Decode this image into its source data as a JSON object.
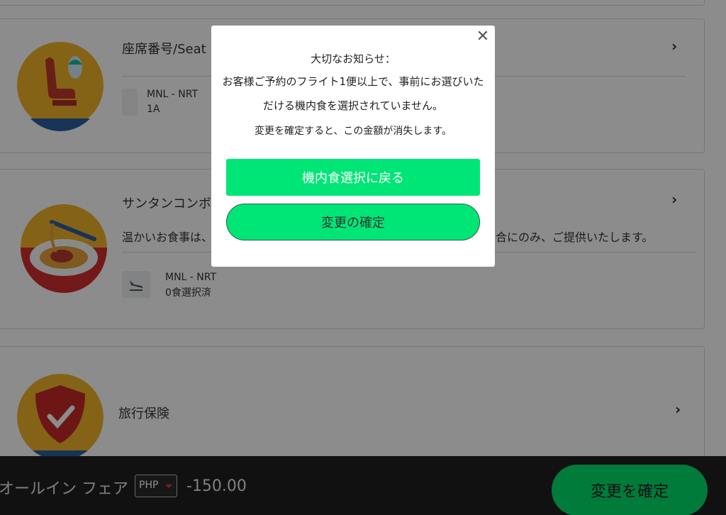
{
  "seat_card": {
    "title": "座席番号/Seat",
    "route": "MNL - NRT",
    "seat": "1A"
  },
  "meal_card": {
    "title": "サンタンコンボ",
    "desc_left": "温かいお食事は、",
    "desc_right": "合にのみ、ご提供いたします。",
    "route": "MNL - NRT",
    "status": "0食選択済"
  },
  "insurance_card": {
    "title": "旅行保険"
  },
  "footer": {
    "fare_label": "オールイン フェア",
    "currency": "PHP",
    "amount": "-150.00",
    "confirm_label": "変更を確定"
  },
  "modal": {
    "close_symbol": "✕",
    "heading": "大切なお知らせ：",
    "line1": "お客様ご予約のフライト1便以上で、事前にお選びいた",
    "line2": "だける機内食を選択されていません。",
    "line3": "変更を確定すると、この金額が消失します。",
    "back_label": "機内食選択に戻る",
    "confirm_label": "変更の確定"
  },
  "colors": {
    "accent_green": "#00e676",
    "footer_bg": "#1f1f1f",
    "overlay": "rgba(0,0,0,0.45)"
  },
  "chevron_symbol": "›"
}
